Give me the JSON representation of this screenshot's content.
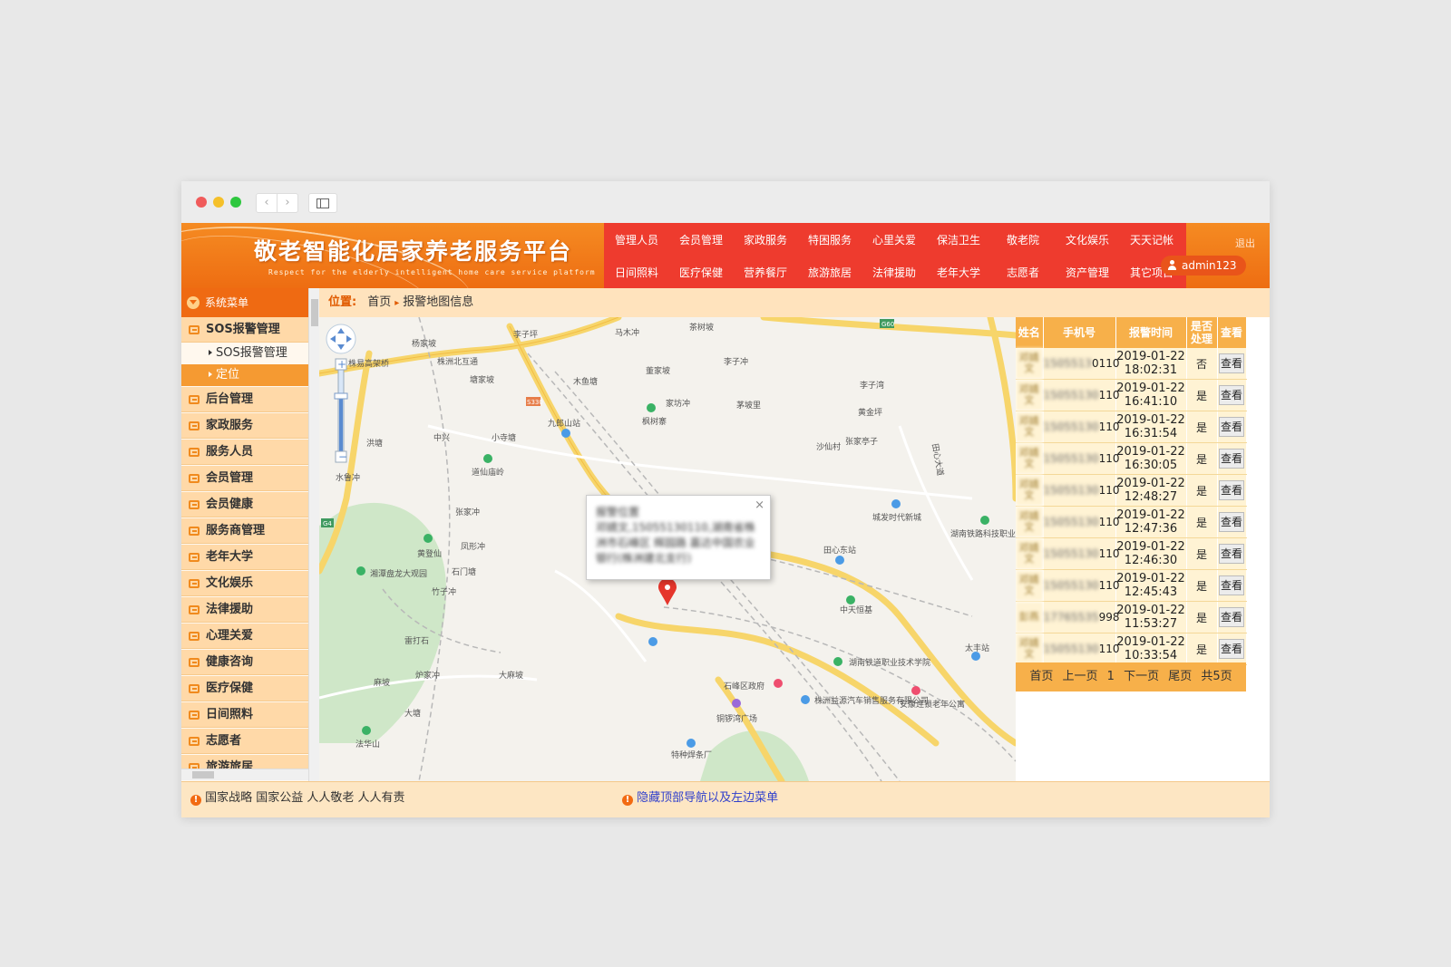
{
  "header": {
    "title": "敬老智能化居家养老服务平台",
    "subtitle": "Respect for the elderly intelligent home care service platform",
    "nav_row1": [
      "管理人员",
      "会员管理",
      "家政服务",
      "特困服务",
      "心里关爱",
      "保洁卫生",
      "敬老院",
      "文化娱乐",
      "天天记帐"
    ],
    "nav_row2": [
      "日间照料",
      "医疗保健",
      "营养餐厅",
      "旅游旅居",
      "法律援助",
      "老年大学",
      "志愿者",
      "资产管理",
      "其它项目"
    ],
    "logout": "退出",
    "username": "admin123"
  },
  "sidebar": {
    "title": "系统菜单",
    "group1": "SOS报警管理",
    "sub1": "SOS报警管理",
    "sub2": "定位",
    "items": [
      "后台管理",
      "家政服务",
      "服务人员",
      "会员管理",
      "会员健康",
      "服务商管理",
      "老年大学",
      "文化娱乐",
      "法律援助",
      "心理关爱",
      "健康咨询",
      "医疗保健",
      "日间照料",
      "志愿者",
      "旅游旅居"
    ]
  },
  "breadcrumb": {
    "label": "位置:",
    "home": "首页",
    "current": "报警地图信息"
  },
  "map": {
    "labels": {
      "zhuzhou_bei": "株洲北互通",
      "zhulou_bridge": "株易高架桥",
      "jiulang": "九郎山站",
      "fengshu": "枫树寨",
      "daoxian": "道仙庙岭",
      "chengfa": "城发时代新城",
      "tianxin_east": "田心东站",
      "hunan_tech": "湖南铁路科技职业技术学院(本",
      "zhongtian": "中天恒基",
      "huangdeng": "黄登仙",
      "xiangtan_park": "湘潭盘龙大观园",
      "hunan_rail": "湖南铁道职业技术学院",
      "shifeng_gov": "石峰区政府",
      "zhuzhou_auto": "株洲益源汽车销售服务有限公司",
      "anlian": "安康连锁老年公寓",
      "tongcuo": "铜锣湾广场",
      "fahua": "法华山",
      "tezhong": "特种焊条厂",
      "taifeng": "太丰站",
      "tianxin_road": "田心大道",
      "g60": "G60",
      "s330": "S330",
      "g4": "G4",
      "mamu": "马木冲",
      "yangjia": "杨家坡",
      "lizi": "李子坪",
      "jiaolian": "茶树坡",
      "zhangjia": "张家亭子",
      "lizichong": "李子冲",
      "huangjin": "黄金坪",
      "shaxian": "沙仙村",
      "xiaosi": "小寺塘",
      "shuling": "水鲁冲",
      "zhangjia2": "张家冲",
      "fengxing": "凤形冲",
      "shimen": "石门塘",
      "zhuzi": "竹子冲",
      "leida": "雷打石",
      "lujia": "炉家冲",
      "damafeng": "大麻坡",
      "mapo": "麻坡",
      "dahu": "大塘",
      "zhongxing": "中兴",
      "hongtai": "洪塘",
      "mushan": "木鱼塘",
      "tangjia": "塘家坡",
      "dongjia": "董家坡",
      "jiafang": "家坊冲",
      "maotang": "茅坡里",
      "lizi2": "李子湾"
    },
    "popup_title": "报警位置",
    "popup_body": "邓婧文,15055130110,湖南省株洲市石峰区 辉园路 嘉达中国农业银行(株洲建北支行)"
  },
  "alarms": {
    "headers": {
      "name": "姓名",
      "phone": "手机号",
      "time": "报警时间",
      "handled": "是否处理",
      "view": "查看"
    },
    "rows": [
      {
        "name": "邓婧文",
        "phone_blur": "1505513",
        "phone_tail": "0110",
        "date": "2019-01-22",
        "clock": "18:02:31",
        "handled": "否",
        "view": "查看"
      },
      {
        "name": "邓婧文",
        "phone_blur": "15055130",
        "phone_tail": "110",
        "date": "2019-01-22",
        "clock": "16:41:10",
        "handled": "是",
        "view": "查看"
      },
      {
        "name": "邓婧文",
        "phone_blur": "15055130",
        "phone_tail": "110",
        "date": "2019-01-22",
        "clock": "16:31:54",
        "handled": "是",
        "view": "查看"
      },
      {
        "name": "邓婧文",
        "phone_blur": "15055130",
        "phone_tail": "110",
        "date": "2019-01-22",
        "clock": "16:30:05",
        "handled": "是",
        "view": "查看"
      },
      {
        "name": "邓婧文",
        "phone_blur": "15055130",
        "phone_tail": "110",
        "date": "2019-01-22",
        "clock": "12:48:27",
        "handled": "是",
        "view": "查看"
      },
      {
        "name": "邓婧文",
        "phone_blur": "15055130",
        "phone_tail": "110",
        "date": "2019-01-22",
        "clock": "12:47:36",
        "handled": "是",
        "view": "查看"
      },
      {
        "name": "邓婧文",
        "phone_blur": "15055130",
        "phone_tail": "110",
        "date": "2019-01-22",
        "clock": "12:46:30",
        "handled": "是",
        "view": "查看"
      },
      {
        "name": "邓婧文",
        "phone_blur": "15055130",
        "phone_tail": "110",
        "date": "2019-01-22",
        "clock": "12:45:43",
        "handled": "是",
        "view": "查看"
      },
      {
        "name": "彭燕",
        "phone_blur": "17765535",
        "phone_tail": "998",
        "date": "2019-01-22",
        "clock": "11:53:27",
        "handled": "是",
        "view": "查看"
      },
      {
        "name": "邓婧文",
        "phone_blur": "15055130",
        "phone_tail": "110",
        "date": "2019-01-22",
        "clock": "10:33:54",
        "handled": "是",
        "view": "查看"
      }
    ],
    "pager": {
      "first": "首页",
      "prev": "上一页",
      "page": "1",
      "next": "下一页",
      "last": "尾页",
      "total": "共5页"
    }
  },
  "footer": {
    "slogan": "国家战略 国家公益 人人敬老 人人有责",
    "toggle": "隐藏顶部导航以及左边菜单"
  },
  "colors": {
    "header_orange": "#ee6d12",
    "nav_red": "#ee3b2e",
    "menu_peach": "#ffd9a8",
    "table_head": "#f7b04a",
    "link_blue": "#2f3fcc"
  }
}
